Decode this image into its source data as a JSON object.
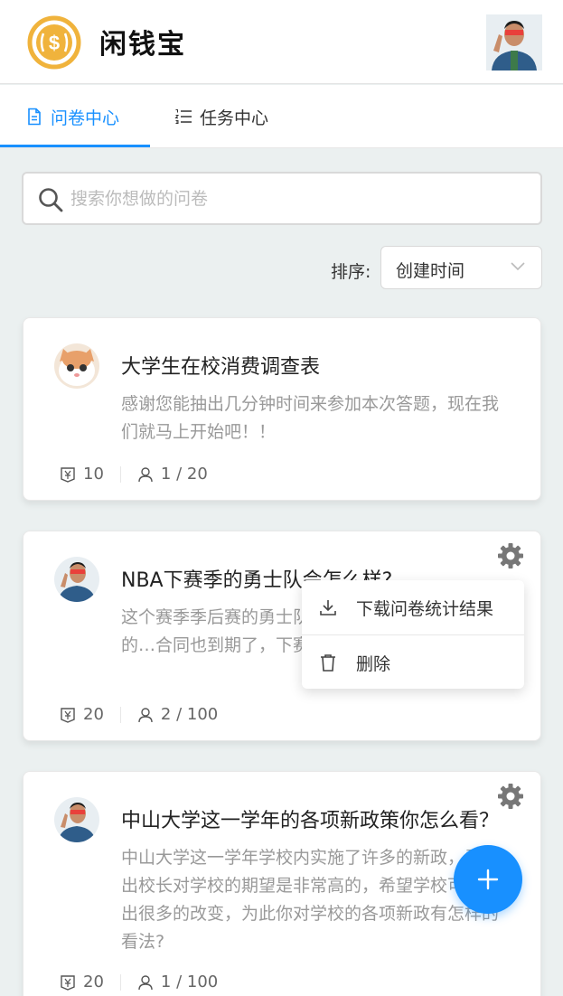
{
  "header": {
    "app_name": "闲钱宝"
  },
  "tabs": [
    {
      "label": "问卷中心",
      "active": true
    },
    {
      "label": "任务中心",
      "active": false
    }
  ],
  "search": {
    "placeholder": "搜索你想做的问卷",
    "value": ""
  },
  "sort": {
    "label": "排序:",
    "selected": "创建时间"
  },
  "cards": [
    {
      "title": "大学生在校消费调查表",
      "description": "感谢您能抽出几分钟时间来参加本次答题，现在我们就马上开始吧！！",
      "reward": "10",
      "participants": "1 / 20",
      "avatar": "cat"
    },
    {
      "title": "NBA下赛季的勇士队会怎么样?",
      "description": "这个赛季季后赛的勇士队…球员皆受到很大程度的…合同也到期了，下赛季…",
      "reward": "20",
      "participants": "2 / 100",
      "avatar": "man"
    },
    {
      "title": "中山大学这一学年的各项新政策你怎么看？",
      "description": "中山大学这一学年学校内实施了许多的新政，看得出校长对学校的期望是非常高的，希望学校可以做出很多的改变，为此你对学校的各项新政有怎样的看法?",
      "reward": "20",
      "participants": "1 / 100",
      "avatar": "man"
    }
  ],
  "dropdown": {
    "download_label": "下载问卷统计结果",
    "delete_label": "删除"
  },
  "colors": {
    "accent": "#1890ff",
    "coin": "#f0b33c"
  }
}
